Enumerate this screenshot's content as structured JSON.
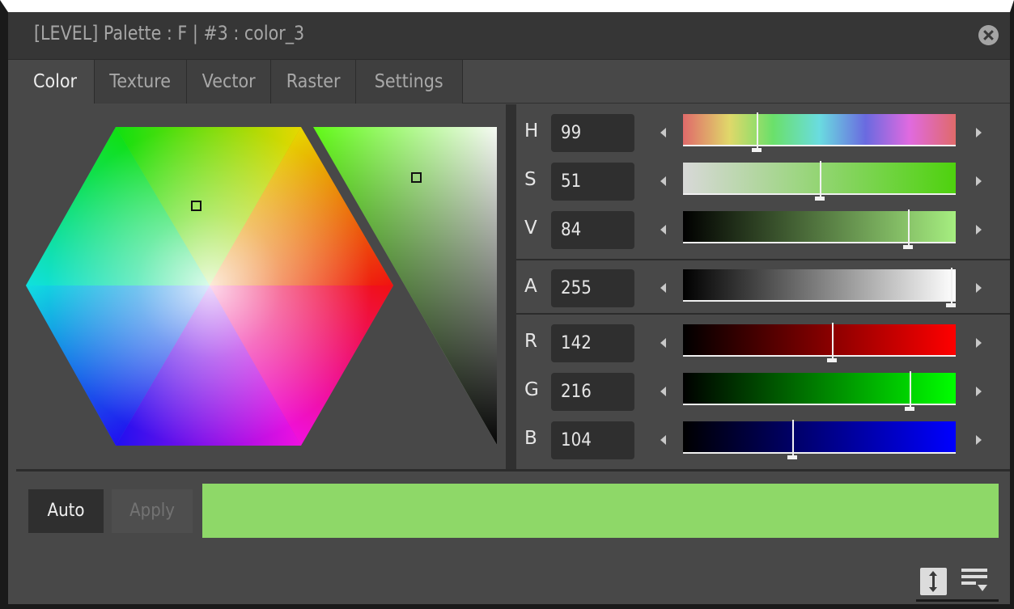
{
  "window": {
    "title": "[LEVEL]  Palette : F | #3 : color_3"
  },
  "tabs": [
    {
      "label": "Color",
      "active": true
    },
    {
      "label": "Texture",
      "active": false
    },
    {
      "label": "Vector",
      "active": false
    },
    {
      "label": "Raster",
      "active": false
    },
    {
      "label": "Settings",
      "active": false
    }
  ],
  "sliders": {
    "H": {
      "label": "H",
      "value": "99",
      "max": 359
    },
    "S": {
      "label": "S",
      "value": "51",
      "max": 100
    },
    "V": {
      "label": "V",
      "value": "84",
      "max": 100
    },
    "A": {
      "label": "A",
      "value": "255",
      "max": 255
    },
    "R": {
      "label": "R",
      "value": "142",
      "max": 255
    },
    "G": {
      "label": "G",
      "value": "216",
      "max": 255
    },
    "B": {
      "label": "B",
      "value": "104",
      "max": 255
    }
  },
  "current_color": "#8ed868",
  "buttons": {
    "auto": "Auto",
    "apply": "Apply"
  },
  "icons": {
    "close": "close-icon",
    "toggle_vertical": "vertical-resize-icon",
    "menu": "menu-icon"
  }
}
